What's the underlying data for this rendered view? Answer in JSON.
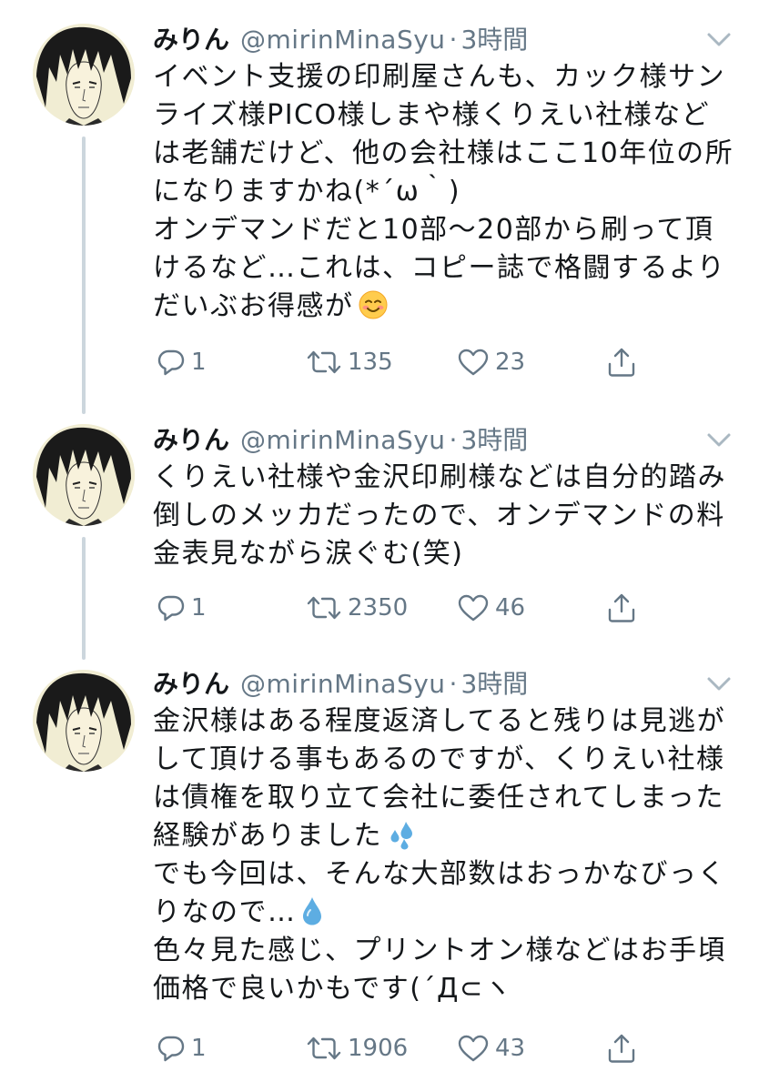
{
  "tweets": [
    {
      "display_name": "みりん",
      "handle": "@mirinMinaSyu",
      "separator": "·",
      "time": "3時間",
      "lines": [
        "イベント支援の印刷屋さんも、カック様サン",
        "ライズ様PICO様しまや様くりえい社様など",
        "は老舗だけど、他の会社様はここ10年位の所",
        "になりますかね(*´ω｀)",
        "オンデマンドだと10部〜20部から刷って頂",
        "けるなど…これは、コピー誌で格闘するより",
        "だいぶお得感が"
      ],
      "emoji": "smiling-face-emoji",
      "replies": "1",
      "retweets": "135",
      "likes": "23"
    },
    {
      "display_name": "みりん",
      "handle": "@mirinMinaSyu",
      "separator": "·",
      "time": "3時間",
      "lines": [
        "くりえい社様や金沢印刷様などは自分的踏み",
        "倒しのメッカだったので、オンデマンドの料",
        "金表見ながら涙ぐむ(笑)"
      ],
      "replies": "1",
      "retweets": "2350",
      "likes": "46"
    },
    {
      "display_name": "みりん",
      "handle": "@mirinMinaSyu",
      "separator": "·",
      "time": "3時間",
      "lines": [
        "金沢様はある程度返済してると残りは見逃が",
        "して頂ける事もあるのですが、くりえい社様",
        "は債権を取り立て会社に委任されてしまった",
        "経験がありました",
        "でも今回は、そんな大部数はおっかなびっく",
        "りなので…",
        "色々見た感じ、プリントオン様などはお手頃",
        "価格で良いかもです(´Д⊂ヽ"
      ],
      "emoji_line3": "sweat-droplets-emoji",
      "emoji_line5": "droplet-emoji",
      "replies": "1",
      "retweets": "1906",
      "likes": "43"
    }
  ],
  "colors": {
    "text": "#14171a",
    "secondary": "#657786",
    "thread_line": "#ccd6dd",
    "emoji_blue": "#5dade2"
  }
}
